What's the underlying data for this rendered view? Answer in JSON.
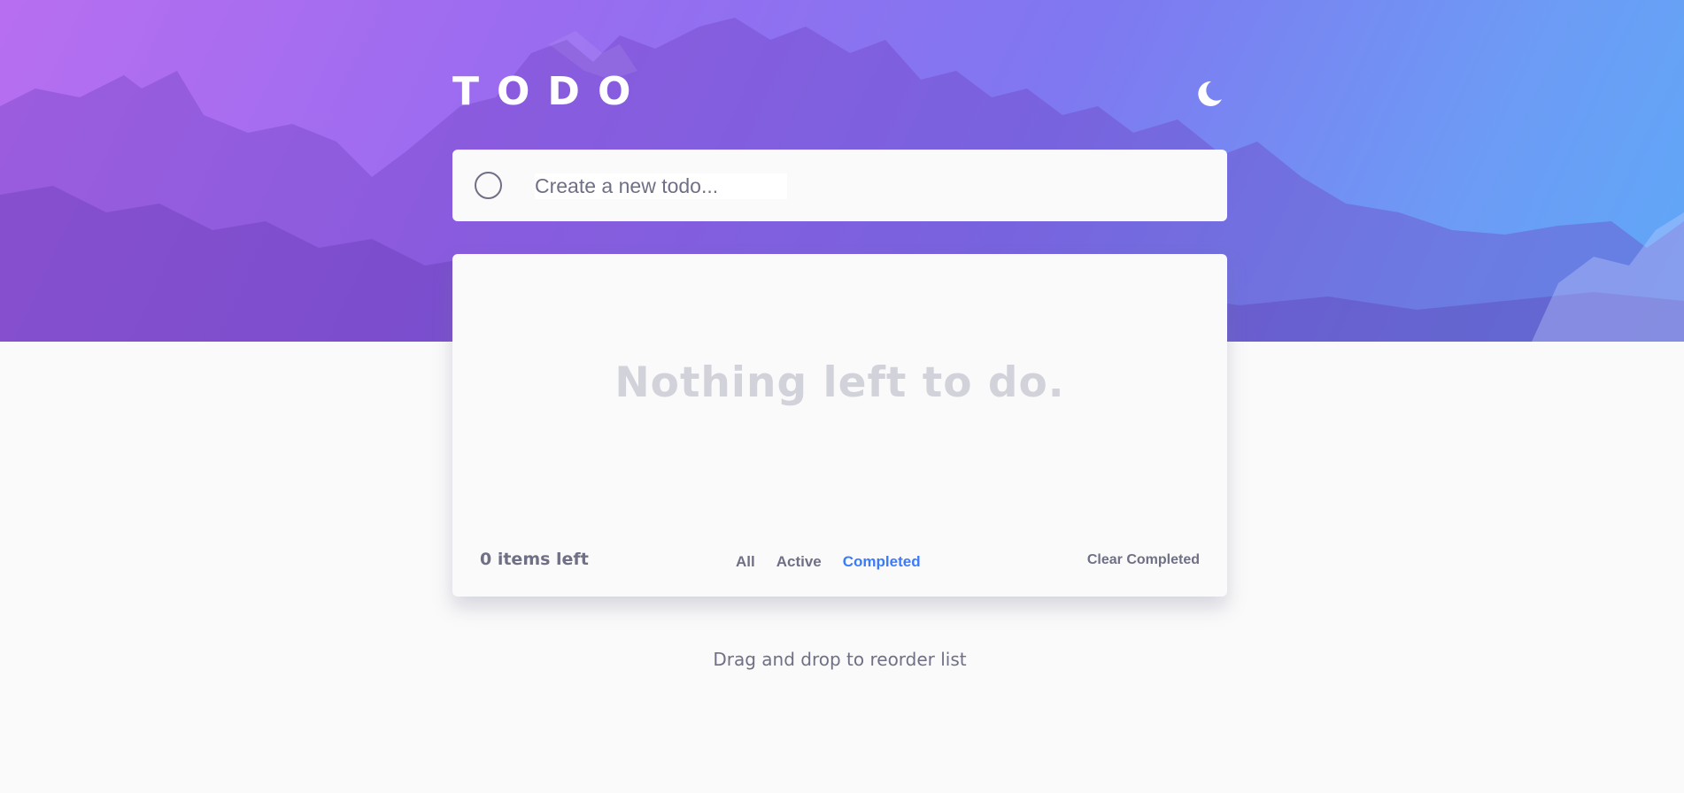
{
  "app": {
    "title": "TODO"
  },
  "header": {
    "theme_icon": "moon-icon"
  },
  "new_todo": {
    "placeholder": "Create a new todo...",
    "value": ""
  },
  "list": {
    "empty_message": "Nothing left to do.",
    "items": []
  },
  "footer": {
    "items_left": "0 items left",
    "filters": [
      "All",
      "Active",
      "Completed"
    ],
    "active_filter": "Completed",
    "clear_label": "Clear Completed"
  },
  "hint": "Drag and drop to reorder list",
  "colors": {
    "accent": "#3a7bfd",
    "text_muted": "#6f7085",
    "empty_text": "#d2d2da",
    "gradient_start": "#b86ef0",
    "gradient_end": "#5fa8f8"
  }
}
